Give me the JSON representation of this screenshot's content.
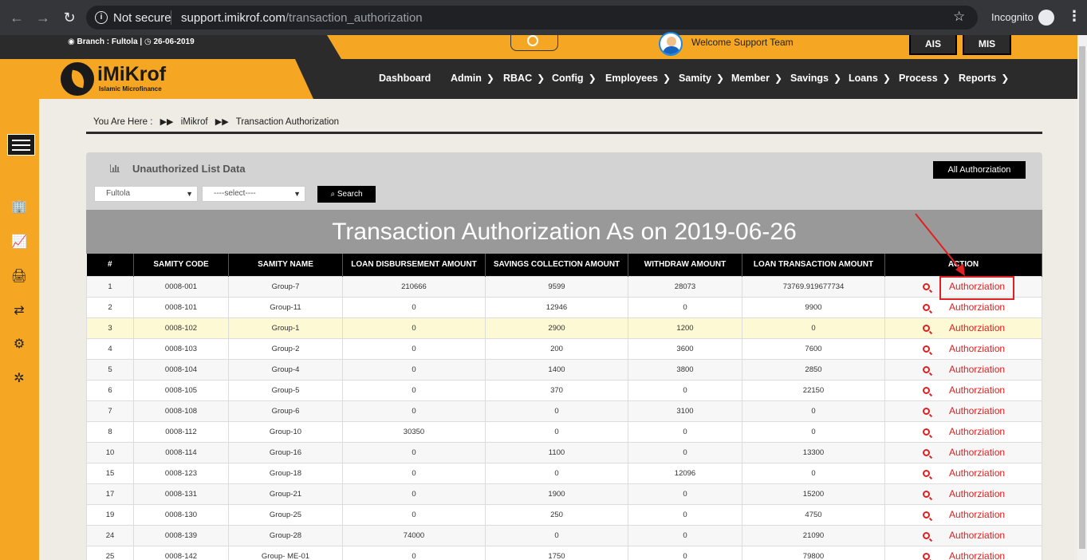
{
  "browser": {
    "security": "Not secure",
    "url_domain": "support.imikrof.com",
    "url_path": "/transaction_authorization",
    "profile": "Incognito"
  },
  "topbar": {
    "branch_text": "Branch : Fultola",
    "date_text": "26-06-2019",
    "welcome": "Welcome Support Team",
    "ais": "AIS",
    "mis": "MIS"
  },
  "logo": {
    "name": "iMiKrof",
    "tagline": "Islamic Microfinance"
  },
  "nav": [
    "Dashboard",
    "Admin",
    "RBAC",
    "Config",
    "Employees",
    "Samity",
    "Member",
    "Savings",
    "Loans",
    "Process",
    "Reports"
  ],
  "breadcrumb": {
    "label": "You Are Here",
    "colon": ":",
    "home": "iMikrof",
    "current": "Transaction Authorization"
  },
  "panel": {
    "title": "Unauthorized List Data",
    "all_button": "All Authorziation",
    "branch_select": "Fultola",
    "samity_select": "----select----",
    "search_button": "Search"
  },
  "banner": "Transaction Authorization As on 2019-06-26",
  "table": {
    "headers": [
      "#",
      "SAMITY CODE",
      "SAMITY NAME",
      "LOAN DISBURSEMENT AMOUNT",
      "SAVINGS COLLECTION AMOUNT",
      "WITHDRAW AMOUNT",
      "LOAN TRANSACTION AMOUNT",
      "ACTION"
    ],
    "action_label": "Authorziation",
    "rows": [
      [
        "1",
        "0008-001",
        "Group-7",
        "210666",
        "9599",
        "28073",
        "73769.919677734"
      ],
      [
        "2",
        "0008-101",
        "Group-11",
        "0",
        "12946",
        "0",
        "9900"
      ],
      [
        "3",
        "0008-102",
        "Group-1",
        "0",
        "2900",
        "1200",
        "0"
      ],
      [
        "4",
        "0008-103",
        "Group-2",
        "0",
        "200",
        "3600",
        "7600"
      ],
      [
        "5",
        "0008-104",
        "Group-4",
        "0",
        "1400",
        "3800",
        "2850"
      ],
      [
        "6",
        "0008-105",
        "Group-5",
        "0",
        "370",
        "0",
        "22150"
      ],
      [
        "7",
        "0008-108",
        "Group-6",
        "0",
        "0",
        "3100",
        "0"
      ],
      [
        "8",
        "0008-112",
        "Group-10",
        "30350",
        "0",
        "0",
        "0"
      ],
      [
        "10",
        "0008-114",
        "Group-16",
        "0",
        "1100",
        "0",
        "13300"
      ],
      [
        "15",
        "0008-123",
        "Group-18",
        "0",
        "0",
        "12096",
        "0"
      ],
      [
        "17",
        "0008-131",
        "Group-21",
        "0",
        "1900",
        "0",
        "15200"
      ],
      [
        "19",
        "0008-130",
        "Group-25",
        "0",
        "250",
        "0",
        "4750"
      ],
      [
        "24",
        "0008-139",
        "Group-28",
        "74000",
        "0",
        "0",
        "21090"
      ],
      [
        "25",
        "0008-142",
        "Group- ME-01",
        "0",
        "1750",
        "0",
        "79800"
      ]
    ]
  }
}
